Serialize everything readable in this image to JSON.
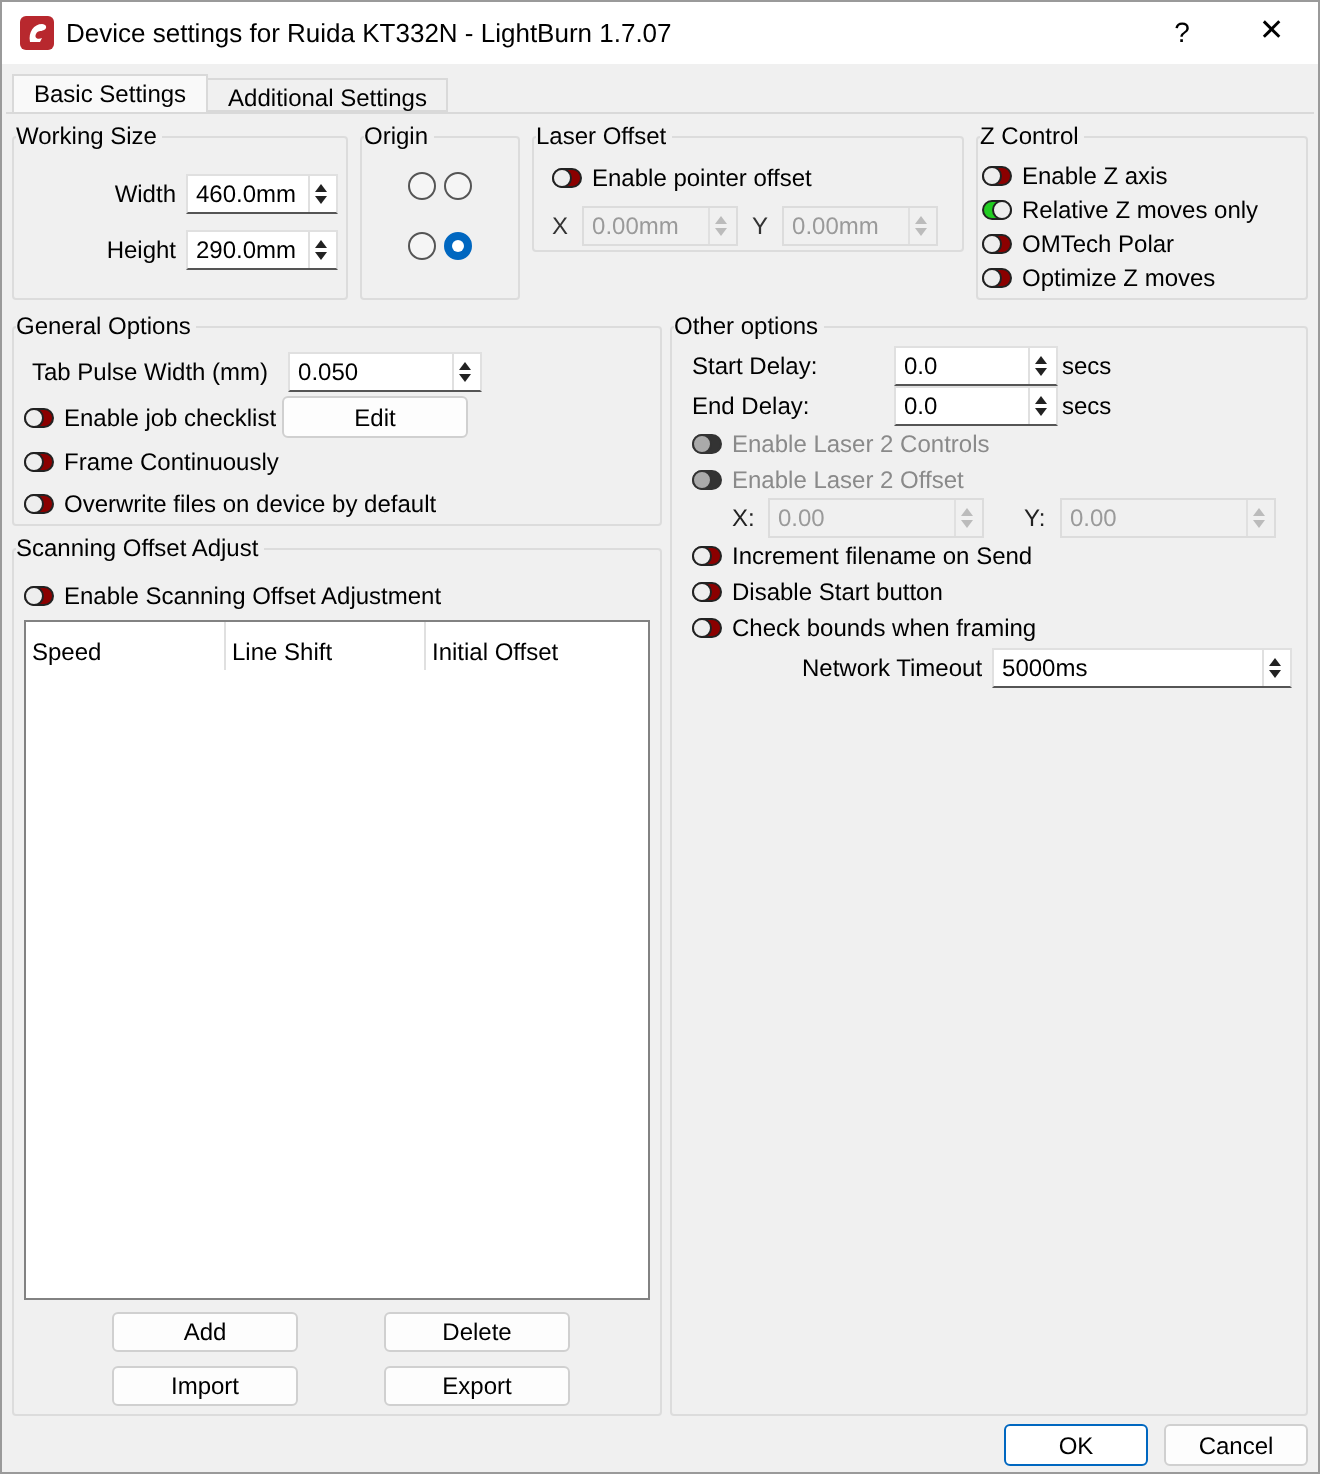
{
  "window": {
    "title": "Device settings for Ruida KT332N - LightBurn 1.7.07",
    "help": "?",
    "close": "✕"
  },
  "tabs": [
    {
      "label": "Basic Settings",
      "selected": true
    },
    {
      "label": "Additional Settings",
      "selected": false
    }
  ],
  "working_size": {
    "title": "Working Size",
    "fields": [
      {
        "label": "Width",
        "value": "460.0mm"
      },
      {
        "label": "Height",
        "value": "290.0mm"
      }
    ]
  },
  "origin": {
    "title": "Origin",
    "corners": [
      {
        "selected": false
      },
      {
        "selected": false
      },
      {
        "selected": false
      },
      {
        "selected": true
      }
    ]
  },
  "laser_offset": {
    "title": "Laser Offset",
    "toggle": {
      "label": "Enable pointer offset",
      "on": false,
      "disabled": false
    },
    "fields": [
      {
        "label": "X",
        "value": "0.00mm",
        "disabled": true
      },
      {
        "label": "Y",
        "value": "0.00mm",
        "disabled": true
      }
    ]
  },
  "z_control": {
    "title": "Z Control",
    "toggles": [
      {
        "label": "Enable Z axis",
        "on": false,
        "disabled": false
      },
      {
        "label": "Relative Z moves only",
        "on": true,
        "disabled": false
      },
      {
        "label": "OMTech Polar",
        "on": false,
        "disabled": false
      },
      {
        "label": "Optimize Z moves",
        "on": false,
        "disabled": false
      }
    ]
  },
  "general_options": {
    "title": "General Options",
    "tab_pulse": {
      "label": "Tab Pulse Width (mm)",
      "value": "0.050"
    },
    "toggles": [
      {
        "label": "Enable job checklist",
        "on": false,
        "disabled": false,
        "button": "Edit"
      },
      {
        "label": "Frame Continuously",
        "on": false,
        "disabled": false
      },
      {
        "label": "Overwrite files on device by default",
        "on": false,
        "disabled": false
      }
    ]
  },
  "scanning_offset": {
    "title": "Scanning Offset Adjust",
    "toggle": {
      "label": "Enable Scanning Offset Adjustment",
      "on": false,
      "disabled": false
    },
    "table": {
      "columns": [
        "Speed",
        "Line Shift",
        "Initial Offset"
      ]
    },
    "buttons": [
      "Add",
      "Delete",
      "Import",
      "Export"
    ]
  },
  "other_options": {
    "title": "Other options",
    "items": [
      {
        "kind": "spin",
        "label": "Start Delay:",
        "value": "0.0",
        "unit": "secs"
      },
      {
        "kind": "spin",
        "label": "End Delay:",
        "value": "0.0",
        "unit": "secs"
      },
      {
        "kind": "toggle",
        "label": "Enable Laser 2 Controls",
        "on": false,
        "disabled": true
      },
      {
        "kind": "toggle",
        "label": "Enable Laser 2 Offset",
        "on": false,
        "disabled": true
      },
      {
        "kind": "xy",
        "fields": [
          {
            "label": "X:",
            "value": "0.00",
            "disabled": true
          },
          {
            "label": "Y:",
            "value": "0.00",
            "disabled": true
          }
        ]
      },
      {
        "kind": "toggle",
        "label": "Increment filename on Send",
        "on": false,
        "disabled": false
      },
      {
        "kind": "toggle",
        "label": "Disable Start button",
        "on": false,
        "disabled": false
      },
      {
        "kind": "toggle",
        "label": "Check bounds when framing",
        "on": false,
        "disabled": false
      },
      {
        "kind": "wide",
        "label": "Network Timeout",
        "value": "5000ms"
      }
    ]
  },
  "dialog_buttons": [
    {
      "label": "OK",
      "default": true
    },
    {
      "label": "Cancel",
      "default": false
    }
  ]
}
